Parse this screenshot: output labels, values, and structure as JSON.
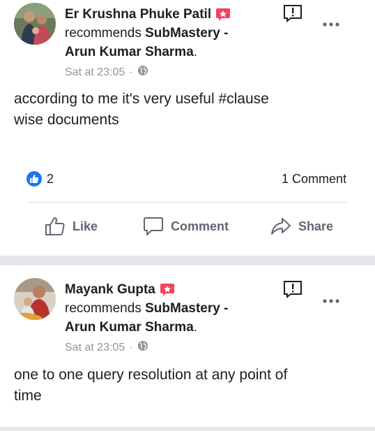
{
  "posts": [
    {
      "author": "Er Krushna Phuke Patil",
      "recommend_prefix": "recommends",
      "page_name_line1": "SubMastery -",
      "page_name_line2": "Arun Kumar Sharma",
      "page_name_suffix": ".",
      "timestamp": "Sat at 23:05",
      "meta_separator": "·",
      "body_line1": "according to me it's very useful #clause",
      "body_line2": "wise documents",
      "like_count": "2",
      "comment_count": "1 Comment",
      "actions": {
        "like": "Like",
        "comment": "Comment",
        "share": "Share"
      }
    },
    {
      "author": "Mayank Gupta",
      "recommend_prefix": "recommends",
      "page_name_line1": "SubMastery -",
      "page_name_line2": "Arun Kumar Sharma",
      "page_name_suffix": ".",
      "timestamp": "Sat at 23:05",
      "meta_separator": "·",
      "body_line1": "one to one query resolution at any point of",
      "body_line2": "time"
    }
  ],
  "icons": {
    "recommend_badge": "recommend-badge-icon",
    "report": "report-icon",
    "more": "more-options-icon",
    "privacy": "globe-icon",
    "like": "thumbs-up-icon",
    "comment": "comment-icon",
    "share": "share-icon"
  },
  "colors": {
    "brand_blue": "#1877f2",
    "recommend_red": "#f3425f",
    "secondary_text": "#90949c",
    "action_text": "#606770",
    "separator": "#e4e6eb"
  }
}
